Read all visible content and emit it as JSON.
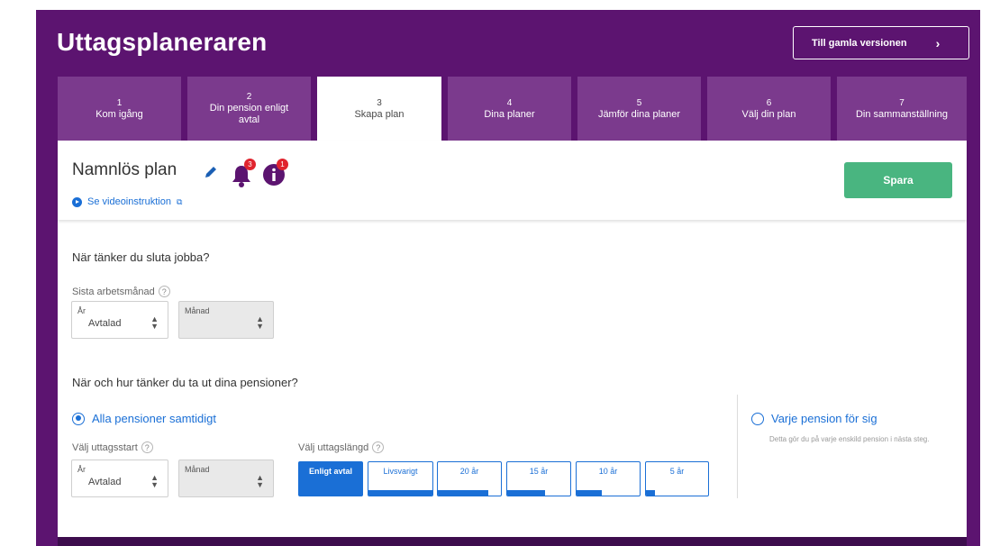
{
  "app": {
    "title": "Uttagsplaneraren",
    "old_version_label": "Till gamla versionen",
    "old_version_chevron": "›"
  },
  "colors": {
    "brand_purple": "#5c1470",
    "tab_inactive": "#7b3a8d",
    "accent_blue": "#1a6fd6",
    "save_green": "#49b580",
    "badge_red": "#e0242e"
  },
  "tabs": [
    {
      "num": "1",
      "label": "Kom igång"
    },
    {
      "num": "2",
      "label": "Din pension enligt avtal"
    },
    {
      "num": "3",
      "label": "Skapa plan"
    },
    {
      "num": "4",
      "label": "Dina planer"
    },
    {
      "num": "5",
      "label": "Jämför dina planer"
    },
    {
      "num": "6",
      "label": "Välj din plan"
    },
    {
      "num": "7",
      "label": "Din sammanställning"
    }
  ],
  "plan": {
    "name": "Namnlös plan",
    "bell_count": "3",
    "info_count": "1",
    "video_link": "Se videoinstruktion",
    "save_label": "Spara"
  },
  "stop_work": {
    "question": "När tänker du sluta jobba?",
    "field_label": "Sista arbetsmånad",
    "help": "?",
    "year_small": "År",
    "year_value": "Avtalad",
    "month_small": "Månad"
  },
  "withdrawal": {
    "question": "När och hur tänker du ta ut dina pensioner?",
    "all_option": "Alla pensioner samtidigt",
    "each_option": "Varje pension för sig",
    "each_desc": "Detta gör du på varje enskild pension i nästa steg.",
    "start_label": "Välj uttagsstart",
    "year_small": "År",
    "year_value": "Avtalad",
    "month_small": "Månad",
    "length_label": "Välj uttagslängd",
    "length_options": [
      {
        "label": "Enligt avtal",
        "fill": 1.0
      },
      {
        "label": "Livsvarigt",
        "fill": 1.0
      },
      {
        "label": "20 år",
        "fill": 0.8
      },
      {
        "label": "15 år",
        "fill": 0.6
      },
      {
        "label": "10 år",
        "fill": 0.4
      },
      {
        "label": "5 år",
        "fill": 0.15
      }
    ]
  }
}
